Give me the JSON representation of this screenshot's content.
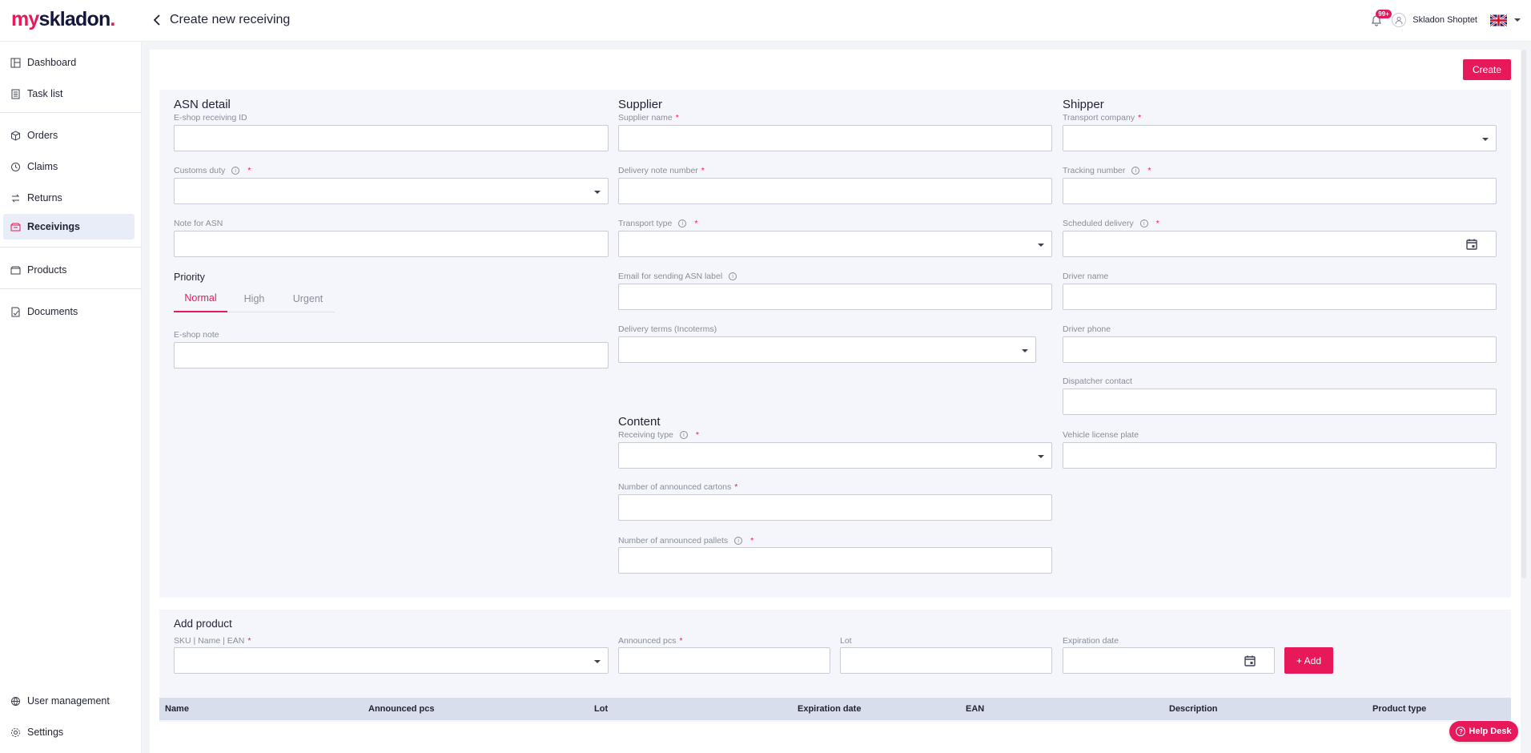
{
  "header": {
    "logo_prefix": "my",
    "logo_main": "skladon",
    "logo_dot": ".",
    "page_title": "Create new receiving",
    "notifications_badge": "99+",
    "user_name": "Skladon Shoptet"
  },
  "sidebar": {
    "items": [
      {
        "label": "Dashboard",
        "icon": "dashboard-icon"
      },
      {
        "label": "Task list",
        "icon": "task-list-icon"
      },
      {
        "label": "Orders",
        "icon": "box-icon"
      },
      {
        "label": "Claims",
        "icon": "claims-icon"
      },
      {
        "label": "Returns",
        "icon": "returns-icon"
      },
      {
        "label": "Receivings",
        "icon": "receivings-icon",
        "active": true
      },
      {
        "label": "Products",
        "icon": "products-icon"
      },
      {
        "label": "Documents",
        "icon": "documents-icon"
      }
    ],
    "bottom_items": [
      {
        "label": "User management",
        "icon": "globe-icon"
      },
      {
        "label": "Settings",
        "icon": "gear-icon"
      }
    ]
  },
  "actions": {
    "create_label": "Create",
    "add_label": "+ Add",
    "help_label": "Help Desk"
  },
  "asn": {
    "title": "ASN detail",
    "eshop_receiving_id": "E-shop receiving ID",
    "customs_duty": "Customs duty",
    "note_for_asn": "Note for ASN",
    "priority": "Priority",
    "priority_tabs": [
      "Normal",
      "High",
      "Urgent"
    ],
    "eshop_note": "E-shop note"
  },
  "supplier": {
    "title": "Supplier",
    "supplier_name": "Supplier name",
    "delivery_note_number": "Delivery note number",
    "transport_type": "Transport type",
    "email_asn_label": "Email for sending ASN label",
    "delivery_terms": "Delivery terms (Incoterms)"
  },
  "content": {
    "title": "Content",
    "receiving_type": "Receiving type",
    "announced_cartons": "Number of announced cartons",
    "announced_pallets": "Number of announced pallets"
  },
  "shipper": {
    "title": "Shipper",
    "transport_company": "Transport company",
    "tracking_number": "Tracking number",
    "scheduled_delivery": "Scheduled delivery",
    "driver_name": "Driver name",
    "driver_phone": "Driver phone",
    "dispatcher_contact": "Dispatcher contact",
    "vehicle_license_plate": "Vehicle license plate"
  },
  "add_product": {
    "title": "Add product",
    "sku_label": "SKU | Name | EAN",
    "announced_pcs": "Announced pcs",
    "lot": "Lot",
    "expiration_date": "Expiration date"
  },
  "table": {
    "columns": [
      "Name",
      "Announced pcs",
      "Lot",
      "Expiration date",
      "EAN",
      "Description",
      "Product type"
    ]
  },
  "colors": {
    "brand": "#e8195a",
    "navy": "#14173a"
  }
}
